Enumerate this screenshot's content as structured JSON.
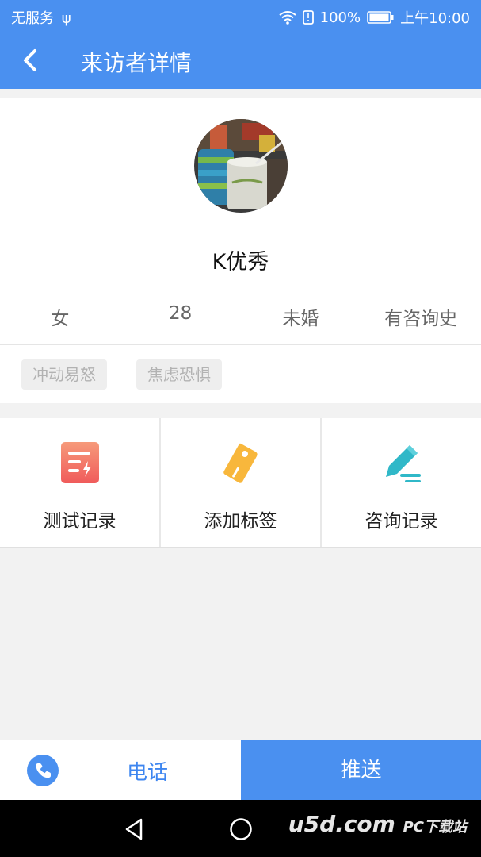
{
  "status": {
    "carrier": "无服务",
    "battery": "100%",
    "time": "上午10:00"
  },
  "toolbar": {
    "title": "来访者详情"
  },
  "profile": {
    "name": "K优秀",
    "gender": "女",
    "age": "28",
    "marital": "未婚",
    "history": "有咨询史"
  },
  "tags": [
    "冲动易怒",
    "焦虑恐惧"
  ],
  "actions": [
    {
      "label": "测试记录",
      "icon": "test-record-icon"
    },
    {
      "label": "添加标签",
      "icon": "tag-icon"
    },
    {
      "label": "咨询记录",
      "icon": "edit-pen-icon"
    }
  ],
  "bottom": {
    "phone_label": "电话",
    "push_label": "推送"
  },
  "watermark": {
    "text": "u5d.com",
    "sub": "PC下载站"
  },
  "colors": {
    "primary": "#4a90f0",
    "tag_bg": "#eeeeee",
    "tag_text": "#b2b2b2",
    "test_icon": "#f3665c",
    "tag_icon": "#f8b73c",
    "edit_icon": "#30b8c8"
  }
}
